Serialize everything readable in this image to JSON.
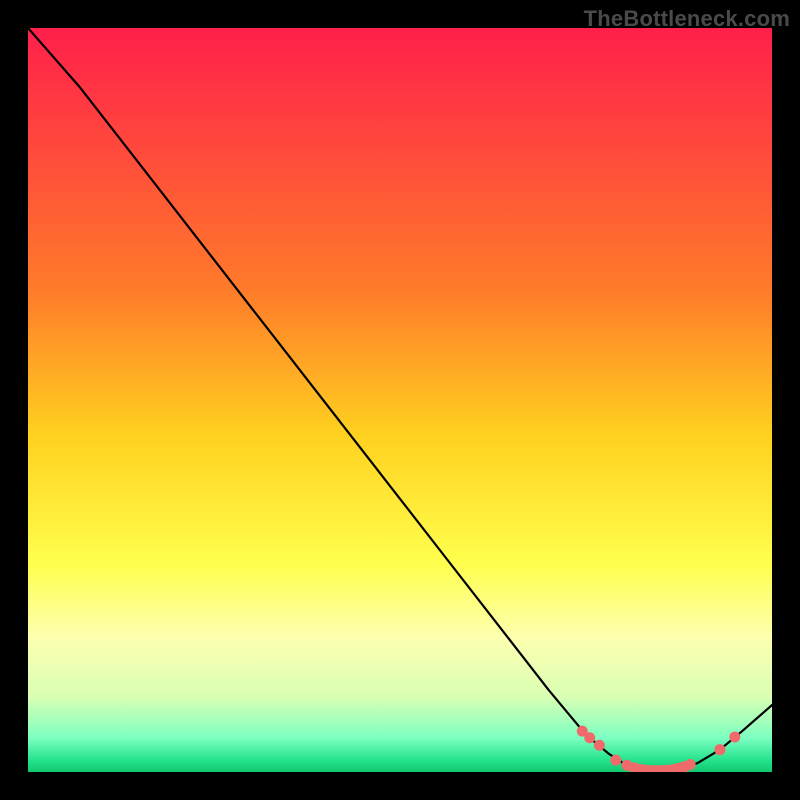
{
  "watermark": "TheBottleneck.com",
  "chart_data": {
    "type": "line",
    "title": "",
    "xlabel": "",
    "ylabel": "",
    "xlim": [
      0,
      100
    ],
    "ylim": [
      0,
      100
    ],
    "grid": false,
    "legend": false,
    "gradient_stops": [
      {
        "offset": 0.0,
        "color": "#ff1f4b"
      },
      {
        "offset": 0.35,
        "color": "#ff7a2a"
      },
      {
        "offset": 0.55,
        "color": "#ffd21f"
      },
      {
        "offset": 0.72,
        "color": "#ffff4d"
      },
      {
        "offset": 0.82,
        "color": "#fdffb0"
      },
      {
        "offset": 0.9,
        "color": "#d8ffb4"
      },
      {
        "offset": 0.955,
        "color": "#7affc0"
      },
      {
        "offset": 0.985,
        "color": "#22e28a"
      },
      {
        "offset": 1.0,
        "color": "#12c76f"
      }
    ],
    "series": [
      {
        "name": "bottleneck-curve",
        "type": "line",
        "color": "#000000",
        "x": [
          0,
          7,
          14,
          21,
          28,
          35,
          42,
          49,
          56,
          63,
          70,
          75,
          78,
          80,
          82,
          84,
          86,
          88,
          90,
          93,
          96,
          100
        ],
        "y": [
          100,
          92,
          83,
          74,
          65,
          56,
          47,
          38,
          29,
          20,
          11,
          5,
          2.5,
          1.2,
          0.5,
          0.2,
          0.2,
          0.5,
          1.2,
          3,
          5.5,
          9
        ]
      },
      {
        "name": "highlight-dots",
        "type": "scatter",
        "color": "#ef6a6a",
        "x": [
          74.5,
          75.5,
          76.8,
          79.0,
          80.5,
          81.5,
          82.3,
          83.0,
          83.8,
          84.5,
          85.3,
          86.0,
          86.8,
          87.5,
          88.2,
          89.0,
          93.0,
          95.0
        ],
        "y": [
          5.5,
          4.6,
          3.6,
          1.6,
          0.9,
          0.55,
          0.35,
          0.25,
          0.2,
          0.2,
          0.2,
          0.25,
          0.35,
          0.5,
          0.7,
          1.0,
          3.0,
          4.7
        ]
      }
    ]
  }
}
